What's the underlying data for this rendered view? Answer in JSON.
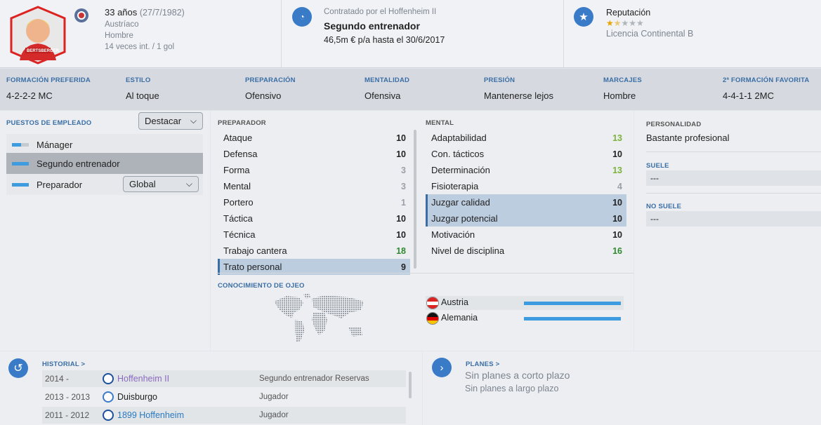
{
  "header": {
    "age_text": "33 años",
    "dob": "(27/7/1982)",
    "nationality": "Austríaco",
    "gender": "Hombre",
    "caps": "14 veces int. / 1 gol",
    "shirt_name": "BERTSBERGER",
    "contract_label": "Contratado por el Hoffenheim II",
    "role": "Segundo entrenador",
    "wage": "46,5m € p/a hasta el 30/6/2017",
    "reputation_label": "Reputación",
    "reputation_stars": 1.5,
    "reputation_stars_max": 5,
    "license": "Licencia Continental B"
  },
  "attributes": [
    {
      "label": "FORMACIÓN PREFERIDA",
      "value": "4-2-2-2 MC"
    },
    {
      "label": "ESTILO",
      "value": "Al toque"
    },
    {
      "label": "PREPARACIÓN",
      "value": "Ofensivo"
    },
    {
      "label": "MENTALIDAD",
      "value": "Ofensiva"
    },
    {
      "label": "PRESIÓN",
      "value": "Mantenerse lejos"
    },
    {
      "label": "MARCAJES",
      "value": "Hombre"
    },
    {
      "label": "2ª FORMACIÓN FAVORITA",
      "value": "4-4-1-1 2MC"
    }
  ],
  "jobs": {
    "title": "PUESTOS DE EMPLEADO",
    "dropdown": "Destacar",
    "items": [
      {
        "label": "Mánager",
        "fill": 0.55
      },
      {
        "label": "Segundo entrenador",
        "fill": 1
      },
      {
        "label": "Preparador",
        "fill": 1
      }
    ],
    "trainer_dropdown": "Global"
  },
  "coaching": {
    "title": "PREPARADOR",
    "rows": [
      {
        "label": "Ataque",
        "value": "10"
      },
      {
        "label": "Defensa",
        "value": "10"
      },
      {
        "label": "Forma",
        "value": "3"
      },
      {
        "label": "Mental",
        "value": "3"
      },
      {
        "label": "Portero",
        "value": "1"
      },
      {
        "label": "Táctica",
        "value": "10"
      },
      {
        "label": "Técnica",
        "value": "10"
      },
      {
        "label": "Trabajo cantera",
        "value": "18"
      },
      {
        "label": "Trato personal",
        "value": "9"
      }
    ]
  },
  "mental": {
    "title": "MENTAL",
    "rows": [
      {
        "label": "Adaptabilidad",
        "value": "13"
      },
      {
        "label": "Con. tácticos",
        "value": "10"
      },
      {
        "label": "Determinación",
        "value": "13"
      },
      {
        "label": "Fisioterapia",
        "value": "4"
      },
      {
        "label": "Juzgar calidad",
        "value": "10"
      },
      {
        "label": "Juzgar potencial",
        "value": "10"
      },
      {
        "label": "Motivación",
        "value": "10"
      },
      {
        "label": "Nivel de disciplina",
        "value": "16"
      }
    ]
  },
  "personality": {
    "title": "PERSONALIDAD",
    "value": "Bastante profesional",
    "likes_title": "SUELE",
    "likes_value": "---",
    "dislikes_title": "NO SUELE",
    "dislikes_value": "---"
  },
  "scouting": {
    "title": "CONOCIMIENTO DE OJEO",
    "countries": [
      {
        "name": "Austria",
        "level": 1
      },
      {
        "name": "Alemania",
        "level": 1
      }
    ]
  },
  "history": {
    "title": "HISTORIAL >",
    "rows": [
      {
        "years": "2014 -",
        "club": "Hoffenheim II",
        "role": "Segundo entrenador Reservas"
      },
      {
        "years": "2013 - 2013",
        "club": "Duisburgo",
        "role": "Jugador"
      },
      {
        "years": "2011 - 2012",
        "club": "1899 Hoffenheim",
        "role": "Jugador"
      }
    ]
  },
  "plans": {
    "title": "PLANES >",
    "short": "Sin planes a corto plazo",
    "long": "Sin planes a largo plazo"
  },
  "colors": {
    "accent": "#3a6ea5",
    "bar": "#3d9be0",
    "green": "#7bb33a",
    "dark_green": "#2f8a2f"
  }
}
